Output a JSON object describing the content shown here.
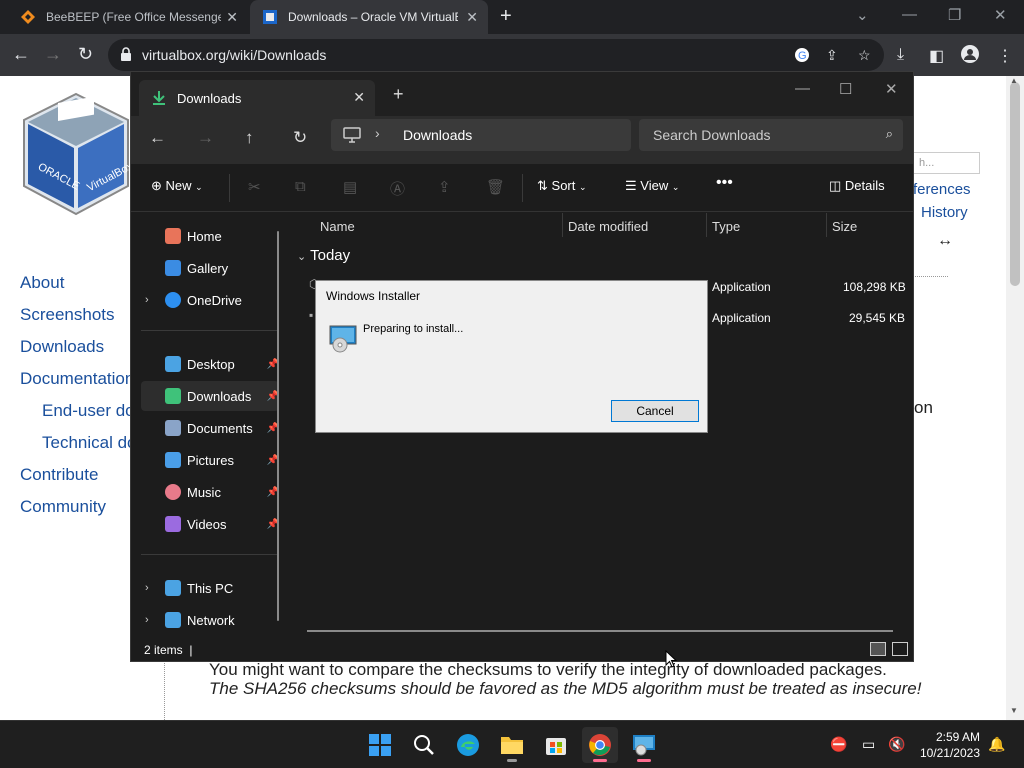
{
  "browser": {
    "tabs": [
      {
        "title": "BeeBEEP (Free Office Messenger)"
      },
      {
        "title": "Downloads – Oracle VM VirtualBox"
      }
    ],
    "url": "virtualbox.org/wiki/Downloads"
  },
  "webpage": {
    "sidebar_links": [
      "About",
      "Screenshots",
      "Downloads",
      "Documentation",
      "End-user docs",
      "Technical docs",
      "Contribute",
      "Community"
    ],
    "right_links": [
      "ferences",
      "History"
    ],
    "search_placeholder": "h...",
    "cut_text": "on",
    "paragraph_line1": "You might want to compare the checksums to verify the integrity of downloaded packages.",
    "paragraph_line2": "The SHA256 checksums should be favored as the MD5 algorithm must be treated as insecure!"
  },
  "explorer": {
    "tab_title": "Downloads",
    "breadcrumb": "Downloads",
    "search_placeholder": "Search Downloads",
    "toolbar": {
      "new": "New",
      "sort": "Sort",
      "view": "View",
      "details": "Details"
    },
    "nav_items": [
      {
        "label": "Home",
        "icon": "home-icon",
        "color": "#e8745a"
      },
      {
        "label": "Gallery",
        "icon": "gallery-icon",
        "color": "#3b8ce3"
      },
      {
        "label": "OneDrive",
        "icon": "onedrive-icon",
        "color": "#2d8ff0"
      },
      {
        "label": "Desktop",
        "icon": "desktop-icon",
        "color": "#4ba3e3"
      },
      {
        "label": "Downloads",
        "icon": "downloads-icon",
        "color": "#3fc27a"
      },
      {
        "label": "Documents",
        "icon": "documents-icon",
        "color": "#8aa4c8"
      },
      {
        "label": "Pictures",
        "icon": "pictures-icon",
        "color": "#4a9ee8"
      },
      {
        "label": "Music",
        "icon": "music-icon",
        "color": "#e87a8a"
      },
      {
        "label": "Videos",
        "icon": "videos-icon",
        "color": "#9b6be0"
      },
      {
        "label": "This PC",
        "icon": "this-pc-icon",
        "color": "#4ba3e3"
      },
      {
        "label": "Network",
        "icon": "network-icon",
        "color": "#4ba3e3"
      }
    ],
    "columns": [
      "Name",
      "Date modified",
      "Type",
      "Size"
    ],
    "group": "Today",
    "files": [
      {
        "type": "Application",
        "size": "108,298 KB"
      },
      {
        "type": "Application",
        "size": "29,545 KB"
      }
    ],
    "status": "2 items"
  },
  "installer": {
    "title": "Windows Installer",
    "message": "Preparing to install...",
    "cancel": "Cancel"
  },
  "taskbar": {
    "time": "2:59 AM",
    "date": "10/21/2023"
  }
}
